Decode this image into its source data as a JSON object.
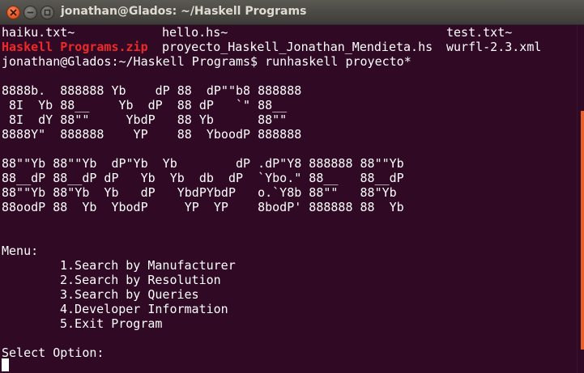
{
  "window": {
    "title": "jonathan@Glados: ~/Haskell Programs"
  },
  "listing": {
    "row1": [
      "haiku.txt~",
      "hello.hs~",
      "test.txt~"
    ],
    "row2": [
      "Haskell Programs.zip",
      "proyecto_Haskell_Jonathan_Mendieta.hs",
      "wurfl-2.3.xml"
    ]
  },
  "prompt": "jonathan@Glados:~/Haskell Programs$ runhaskell proyecto*",
  "banner": [
    "8888b.  888888 Yb    dP 88  dP\"\"b8 888888",
    " 8I  Yb 88__    Yb  dP  88 dP   `\" 88__",
    " 8I  dY 88\"\"     YbdP   88 Yb      88\"\"",
    "8888Y\"  888888    YP    88  YboodP 888888",
    "",
    "88\"\"Yb 88\"\"Yb  dP\"Yb  Yb        dP .dP\"Y8 888888 88\"\"Yb",
    "88__dP 88__dP dP   Yb  Yb  db  dP  `Ybo.\" 88__   88__dP",
    "88\"\"Yb 88\"Yb  Yb   dP   YbdPYbdP   o.`Y8b 88\"\"   88\"Yb",
    "88oodP 88  Yb  YbodP     YP  YP    8bodP' 888888 88  Yb"
  ],
  "menu": {
    "heading": "Menu:",
    "items": [
      "1.Search by Manufacturer",
      "2.Search by Resolution",
      "3.Search by Queries",
      "4.Developer Information",
      "5.Exit Program"
    ]
  },
  "select_prompt": "Select Option:",
  "colors": {
    "background": "#300a24",
    "text": "#ffffff",
    "archive": "#ef2929",
    "accent": "#e8602a"
  },
  "icons": {
    "close": "close-icon",
    "minimize": "minimize-icon",
    "maximize": "maximize-icon"
  }
}
